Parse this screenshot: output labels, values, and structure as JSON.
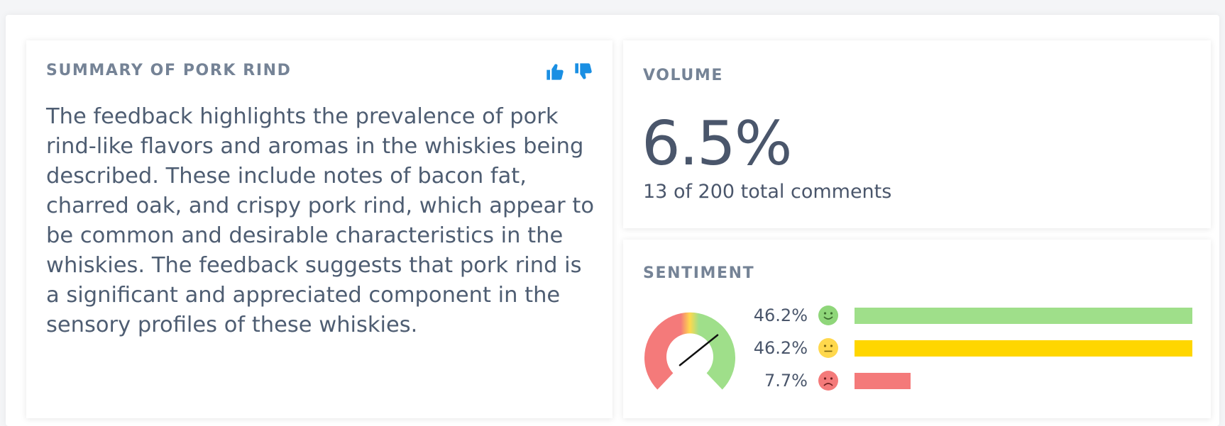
{
  "summary": {
    "title": "SUMMARY OF PORK RIND",
    "text": "The feedback highlights the prevalence of pork rind-like flavors and aromas in the whiskies being described. These include notes of bacon fat, charred oak, and crispy pork rind, which appear to be common and desirable characteristics in the whiskies. The feedback suggests that pork rind is a significant and appreciated component in the sensory profiles of these whiskies.",
    "thumbs_up_icon": "thumbs-up-icon",
    "thumbs_down_icon": "thumbs-down-icon",
    "icon_color": "#1a8fe3"
  },
  "volume": {
    "title": "VOLUME",
    "value": "6.5%",
    "subtitle": "13 of 200 total comments"
  },
  "sentiment": {
    "title": "SENTIMENT",
    "gauge_value": 0.69,
    "rows": [
      {
        "label": "46.2%",
        "value": 0.462,
        "face": "smiley-face-icon",
        "color": "#9fdf8a",
        "face_color": "#8fd67a"
      },
      {
        "label": "46.2%",
        "value": 0.462,
        "face": "neutral-face-icon",
        "color": "#ffd600",
        "face_color": "#ffd84d"
      },
      {
        "label": "7.7%",
        "value": 0.077,
        "face": "sad-face-icon",
        "color": "#f47a7a",
        "face_color": "#f47a7a"
      }
    ]
  }
}
